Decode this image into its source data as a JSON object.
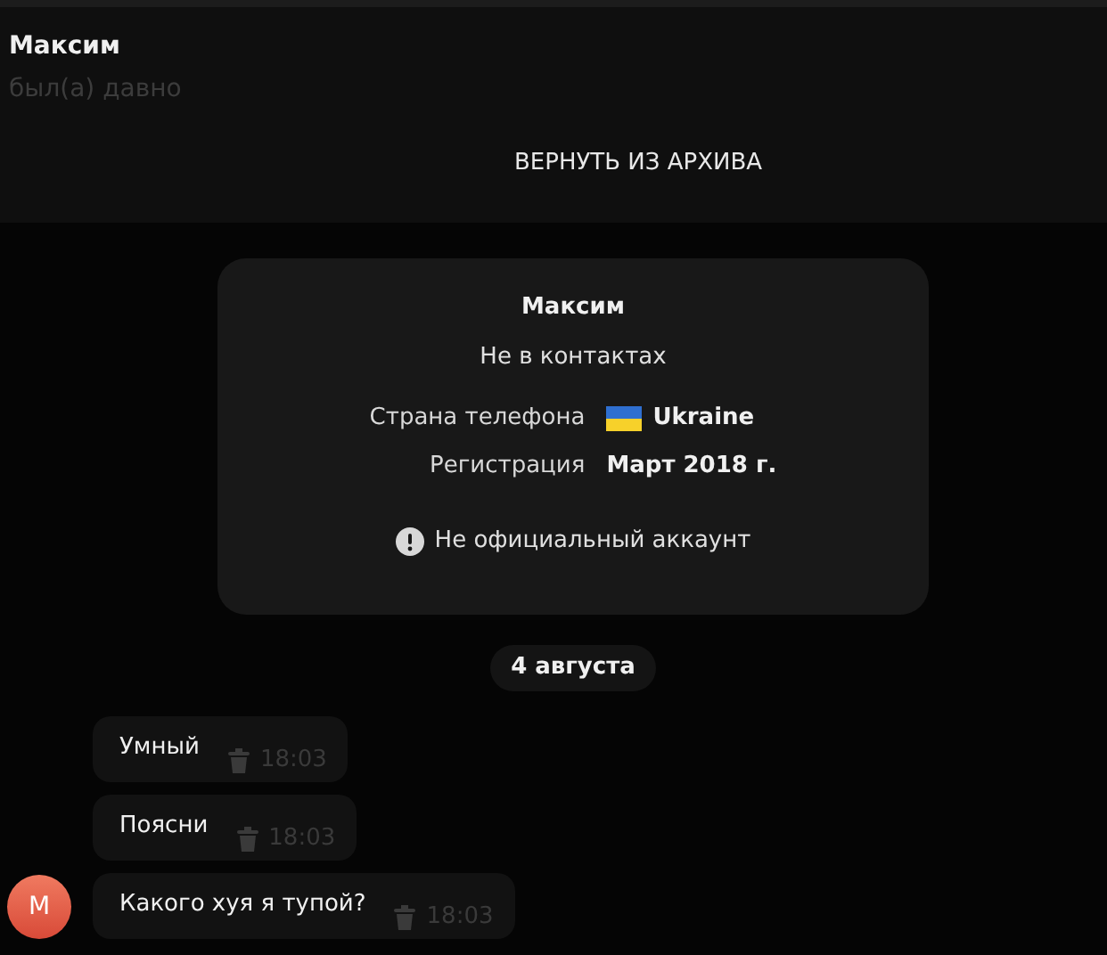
{
  "header": {
    "name": "Максим",
    "status": "был(а) давно"
  },
  "unarchive_button": "ВЕРНУТЬ ИЗ АРХИВА",
  "info_card": {
    "name": "Максим",
    "subtitle": "Не в контактах",
    "rows": [
      {
        "kind": "country",
        "label": "Страна телефона",
        "value": "Ukraine"
      },
      {
        "kind": "plain",
        "label": "Регистрация",
        "value": "Март 2018 г."
      }
    ],
    "notice": "Не официальный аккаунт"
  },
  "date": "4 августа",
  "messages": [
    {
      "text": "Умный",
      "time": "18:03",
      "deleted": true
    },
    {
      "text": "Поясни",
      "time": "18:03",
      "deleted": true
    },
    {
      "text": "Какого хуя я тупой?",
      "time": "18:03",
      "deleted": true,
      "avatar": "М"
    }
  ]
}
